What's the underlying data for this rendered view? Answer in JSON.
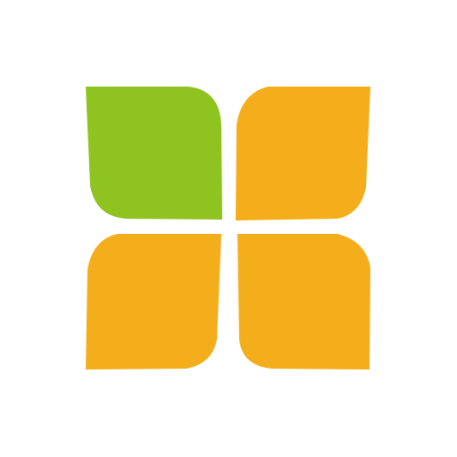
{
  "logo": {
    "name": "four-leaf-tile-logo",
    "tiles": [
      {
        "id": "top-left",
        "color": "#8FC31F"
      },
      {
        "id": "top-right",
        "color": "#F5AE1B"
      },
      {
        "id": "bottom-left",
        "color": "#F5AE1B"
      },
      {
        "id": "bottom-right",
        "color": "#F5AE1B"
      }
    ]
  },
  "colors": {
    "background": "#FFFFFF",
    "green": "#8FC31F",
    "orange": "#F5AE1B"
  }
}
